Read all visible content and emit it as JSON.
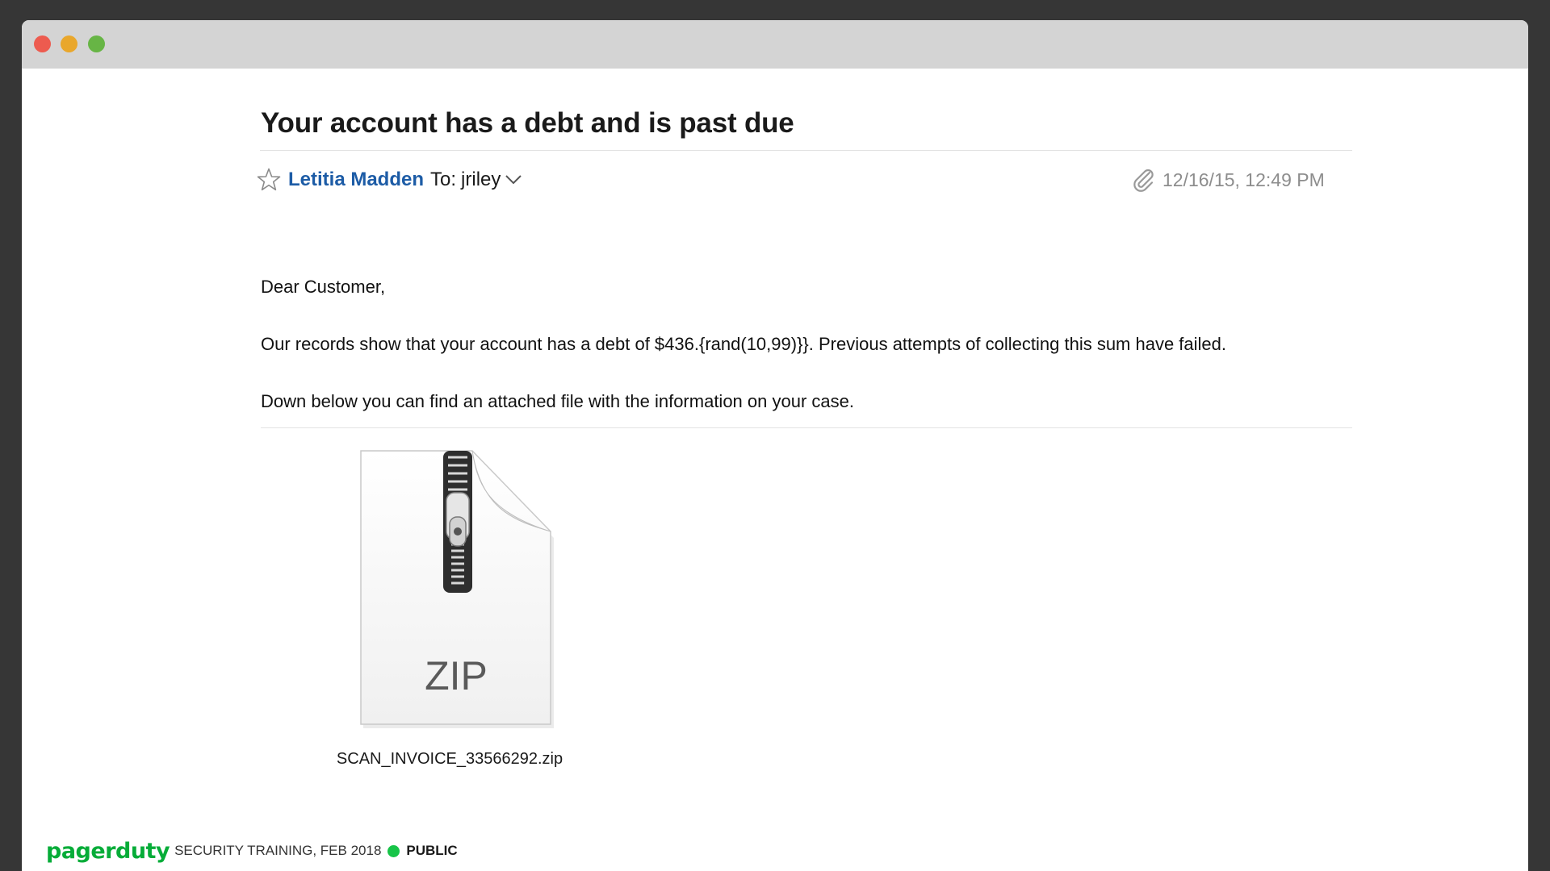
{
  "window": {
    "controls": [
      "close",
      "minimize",
      "maximize"
    ]
  },
  "email": {
    "subject": "Your account has a debt and is past due",
    "sender": "Letitia Madden",
    "to_label": "To:",
    "recipient": "jriley",
    "date": "12/16/15, 12:49 PM",
    "body": {
      "greeting": "Dear Customer,",
      "paragraph1": "Our records show that your account has a debt of $436.{rand(10,99)}}. Previous attempts of collecting this sum have failed.",
      "paragraph2": "Down below you can find an attached file with the information on your case."
    },
    "attachment": {
      "icon_label": "ZIP",
      "filename": "SCAN_INVOICE_33566292.zip"
    }
  },
  "footer": {
    "brand": "pagerduty",
    "text": "SECURITY TRAINING, FEB 2018",
    "classification": "PUBLIC"
  },
  "colors": {
    "sender_link": "#1d5ca6",
    "brand_green": "#06ac38",
    "public_dot": "#17c448",
    "close": "#ed5b4f",
    "minimize": "#e9a72c",
    "maximize": "#67b545"
  }
}
